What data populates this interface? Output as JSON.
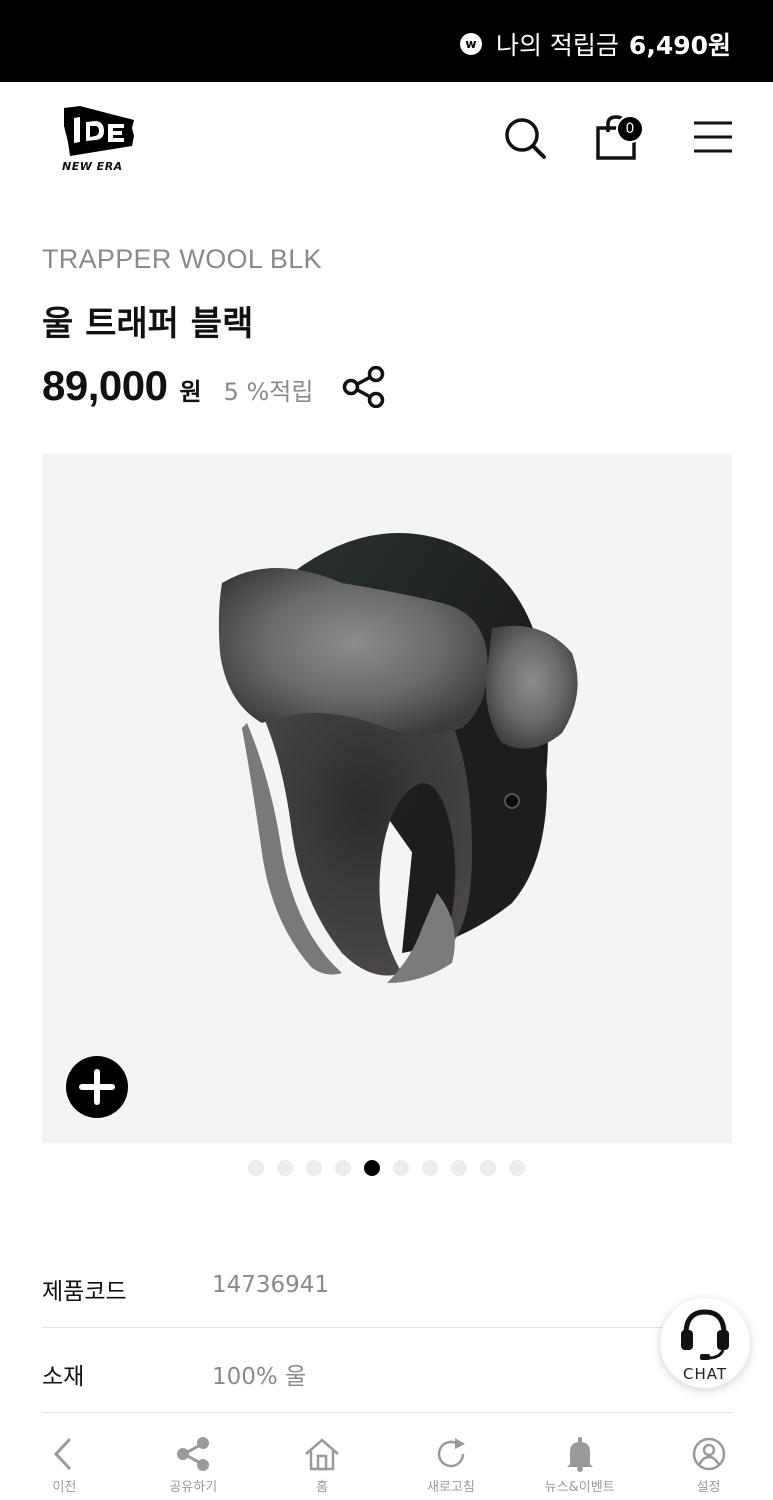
{
  "points_bar": {
    "badge": "w",
    "label": "나의 적립금",
    "value": "6,490원"
  },
  "header": {
    "logo_text": "NEW ERA",
    "cart_count": "0"
  },
  "product": {
    "english_name": "TRAPPER WOOL BLK",
    "korean_name": "울 트래퍼 블랙",
    "price": "89,000",
    "currency": "원",
    "reward": "5 %적립"
  },
  "gallery": {
    "dot_count": 10,
    "active_index": 4
  },
  "details": [
    {
      "label": "제품코드",
      "value": "14736941"
    },
    {
      "label": "소재",
      "value": "100% 울"
    }
  ],
  "chat": {
    "label": "CHAT"
  },
  "bottom_nav": [
    {
      "label": "이전",
      "icon": "back-icon"
    },
    {
      "label": "공유하기",
      "icon": "share-icon"
    },
    {
      "label": "홈",
      "icon": "home-icon"
    },
    {
      "label": "새로고침",
      "icon": "refresh-icon"
    },
    {
      "label": "뉴스&이벤트",
      "icon": "bell-icon"
    },
    {
      "label": "설정",
      "icon": "user-settings-icon"
    }
  ],
  "colors": {
    "bar_bg": "#000000",
    "muted_text": "#8a8a8a",
    "image_bg": "#f4f4f4"
  }
}
